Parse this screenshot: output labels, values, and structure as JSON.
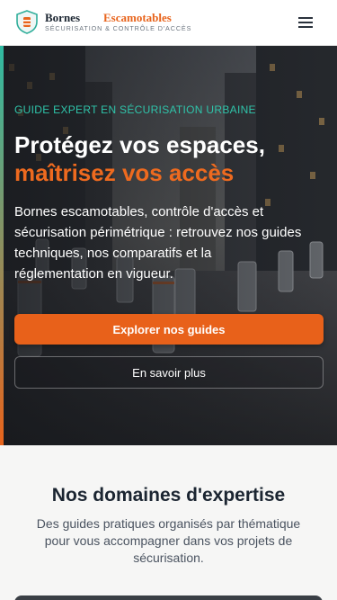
{
  "header": {
    "brand_part1": "Bornes",
    "brand_part2": "Escamotables",
    "tagline": "SÉCURISATION & CONTRÔLE D'ACCÈS",
    "menu_icon": "hamburger-menu-icon",
    "logo_icon": "shield-bollard-icon"
  },
  "hero": {
    "eyebrow": "GUIDE EXPERT EN SÉCURISATION URBAINE",
    "title_line1": "Protégez vos espaces,",
    "title_line2": "maîtrisez vos accès",
    "lead": "Bornes escamotables, contrôle d'accès et sécurisation périmétrique : retrouvez nos guides techniques, nos comparatifs et la réglementation en vigueur.",
    "primary_button": "Explorer nos guides",
    "secondary_button": "En savoir plus"
  },
  "expertise": {
    "title": "Nos domaines d'expertise",
    "lead": "Des guides pratiques organisés par thématique pour vous accompagner dans vos projets de sécurisation."
  },
  "colors": {
    "accent_orange": "#e8611a",
    "accent_teal": "#2fc4aa",
    "navy": "#1b2531"
  }
}
